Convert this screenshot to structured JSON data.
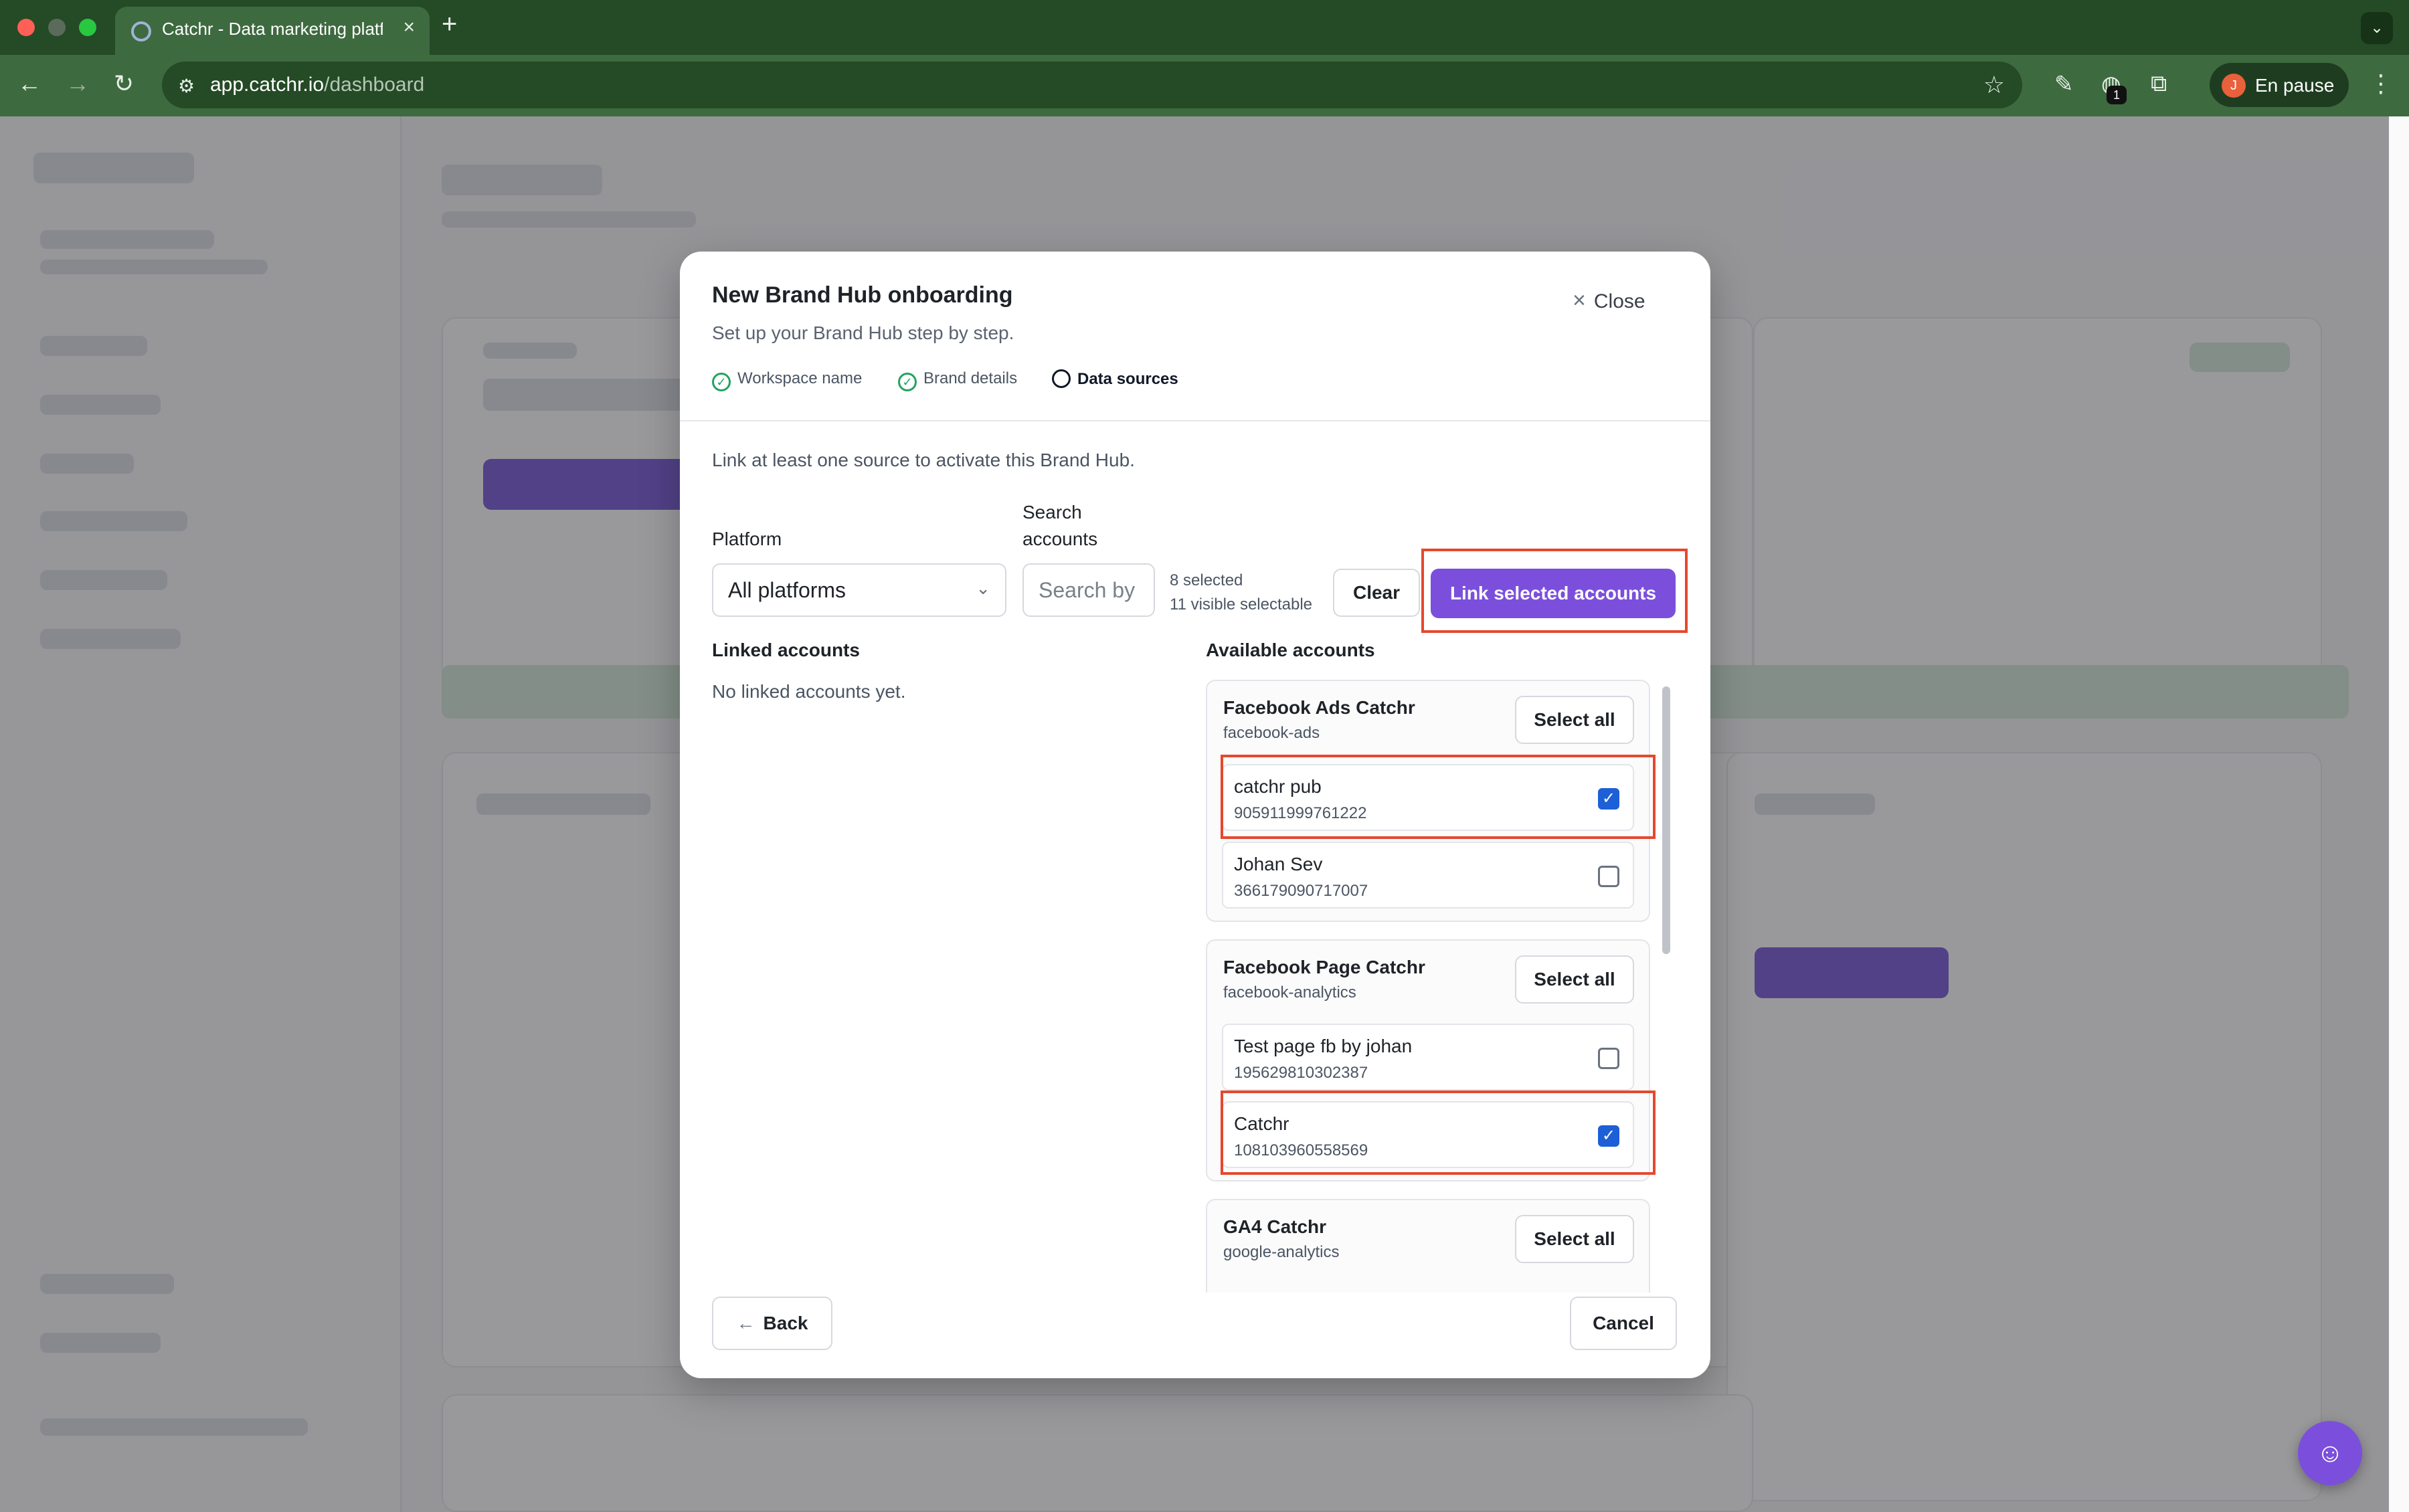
{
  "browser": {
    "tab_title": "Catchr - Data marketing platform",
    "url_host": "app.catchr.io",
    "url_path": "/dashboard",
    "profile_initial": "J",
    "profile_label": "En pause",
    "extension_badge": "1"
  },
  "modal": {
    "title": "New Brand Hub onboarding",
    "subtitle": "Set up your Brand Hub step by step.",
    "close_label": "Close",
    "steps": [
      {
        "label": "Workspace name",
        "status": "done"
      },
      {
        "label": "Brand details",
        "status": "done"
      },
      {
        "label": "Data sources",
        "status": "current"
      }
    ],
    "intro": "Link at least one source to activate this Brand Hub.",
    "filters": {
      "platform_label": "Platform",
      "platform_value": "All platforms",
      "search_label_line1": "Search",
      "search_label_line2": "accounts",
      "search_placeholder": "Search by",
      "selected_count": "8 selected",
      "visible_count": "11 visible selectable",
      "clear_label": "Clear",
      "link_label": "Link selected accounts"
    },
    "linked": {
      "title": "Linked accounts",
      "empty": "No linked accounts yet."
    },
    "available": {
      "title": "Available accounts",
      "select_all_label": "Select all",
      "groups": [
        {
          "name": "Facebook Ads Catchr",
          "slug": "facebook-ads",
          "accounts": [
            {
              "name": "catchr pub",
              "id": "905911999761222",
              "checked": true
            },
            {
              "name": "Johan Sev",
              "id": "366179090717007",
              "checked": false
            }
          ]
        },
        {
          "name": "Facebook Page Catchr",
          "slug": "facebook-analytics",
          "accounts": [
            {
              "name": "Test page fb by johan",
              "id": "195629810302387",
              "checked": false
            },
            {
              "name": "Catchr",
              "id": "108103960558569",
              "checked": true
            }
          ]
        },
        {
          "name": "GA4 Catchr",
          "slug": "google-analytics",
          "accounts": []
        }
      ]
    },
    "back_label": "Back",
    "cancel_label": "Cancel"
  },
  "colors": {
    "accent": "#7b4fdb",
    "checkbox": "#1d5fd6",
    "highlight": "#e5482f",
    "success": "#22a45d",
    "chrome": "#3e6a3f"
  },
  "icons": [
    "close-icon",
    "check-circle-icon",
    "chevron-down-icon",
    "arrow-left-icon",
    "chat-icon"
  ]
}
